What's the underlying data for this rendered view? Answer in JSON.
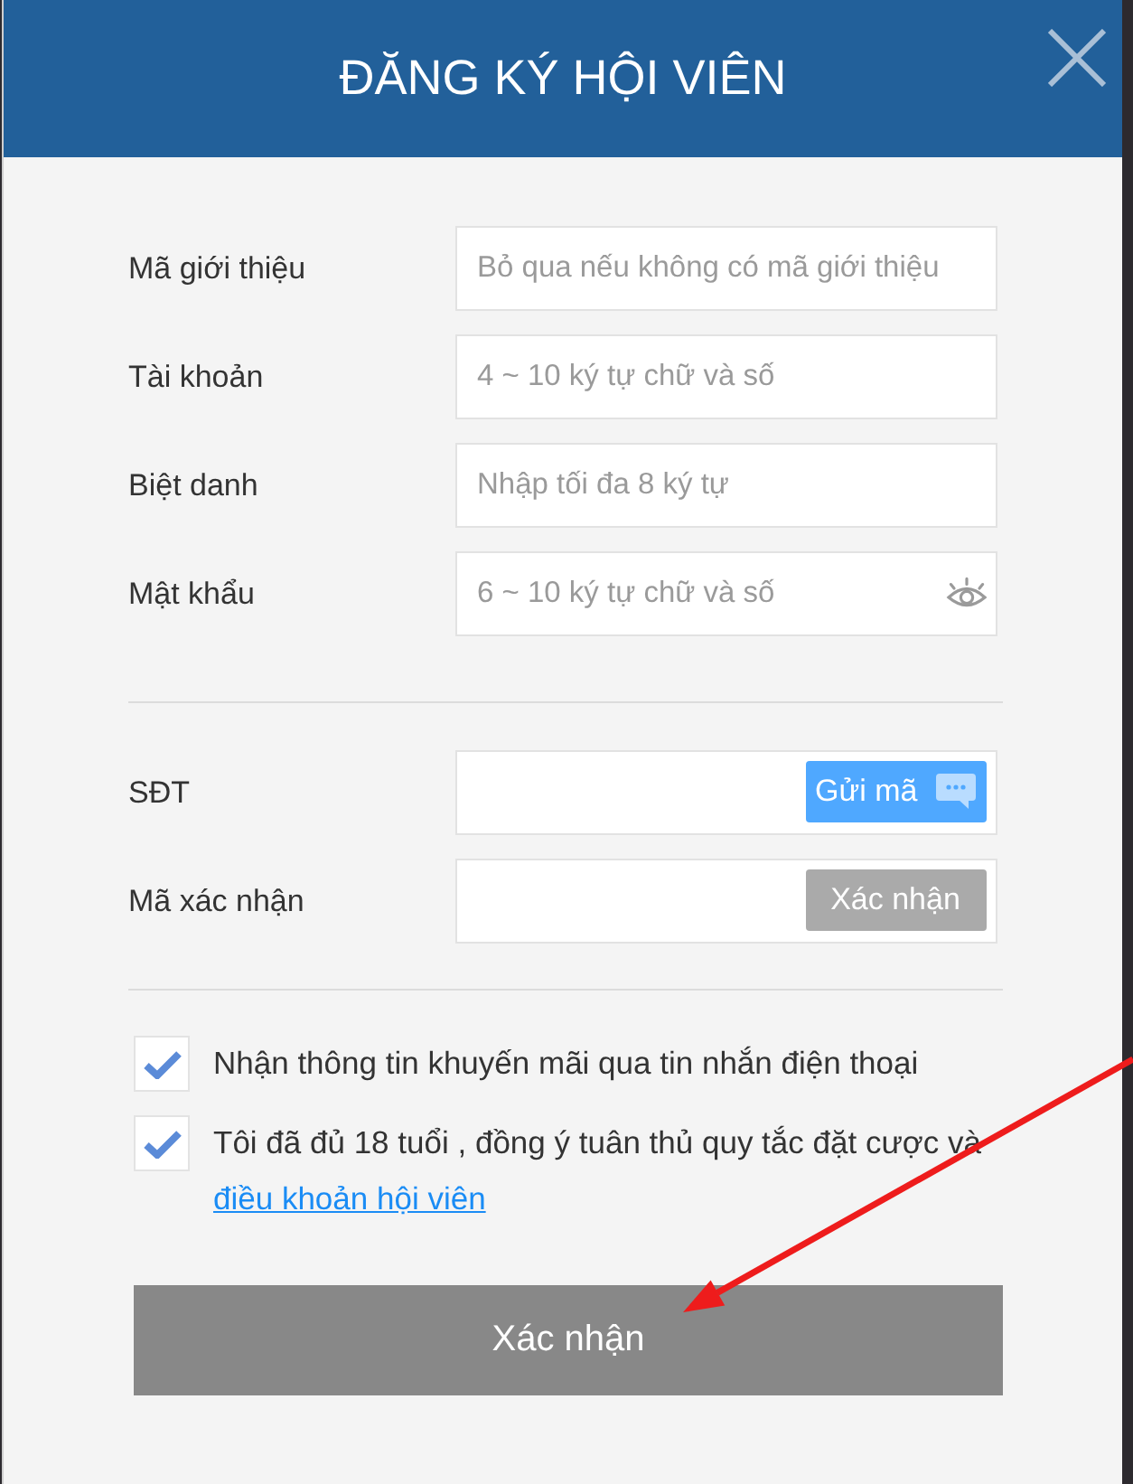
{
  "dialog": {
    "title": "ĐĂNG KÝ HỘI VIÊN"
  },
  "sections": [
    {
      "fields": [
        {
          "kind": "text",
          "label": "Mã giới thiệu",
          "placeholder": "Bỏ qua nếu không có mã giới thiệu"
        },
        {
          "kind": "text",
          "label": "Tài khoản",
          "placeholder": "4 ~ 10 ký tự chữ và số"
        },
        {
          "kind": "text",
          "label": "Biệt danh",
          "placeholder": "Nhập tối đa 8 ký tự"
        },
        {
          "kind": "password",
          "label": "Mật khẩu",
          "placeholder": "6 ~ 10 ký tự chữ và số"
        }
      ]
    },
    {
      "fields": [
        {
          "kind": "phone",
          "label": "SĐT",
          "button": {
            "label": "Gửi mã",
            "disabled": false
          }
        },
        {
          "kind": "code",
          "label": "Mã xác nhận",
          "button": {
            "label": "Xác nhận",
            "disabled": true
          }
        }
      ]
    }
  ],
  "agreements": [
    {
      "text": "Nhận thông tin khuyến mãi qua tin nhắn điện thoại",
      "checked": true
    },
    {
      "text": "Tôi đã đủ 18 tuổi , đồng ý tuân thủ quy tắc đặt cược và",
      "link": "điều khoản hội viên",
      "checked": true
    }
  ],
  "submit": {
    "label": "Xác nhận"
  }
}
